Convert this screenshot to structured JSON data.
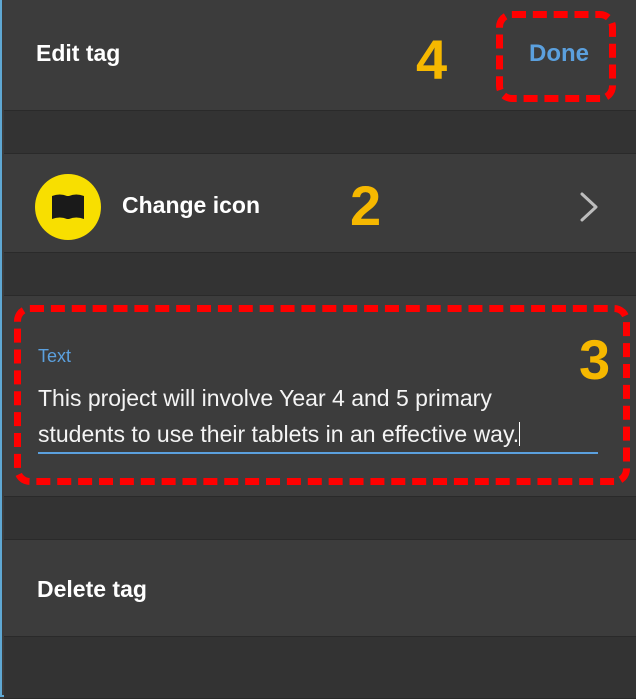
{
  "header": {
    "title": "Edit tag",
    "done_label": "Done"
  },
  "change_icon": {
    "label": "Change icon",
    "icon": "book-icon",
    "chevron": "chevron-right-icon",
    "icon_bg_color": "#f8df00"
  },
  "text_field": {
    "label": "Text",
    "lines": [
      "This project will involve Year 4 and 5 primary",
      "students to use their tablets in an effective way."
    ]
  },
  "delete": {
    "label": "Delete tag"
  },
  "annotations": {
    "step_done": "4",
    "step_change_icon": "2",
    "step_text": "3",
    "highlight_color": "#ff0000",
    "badge_color": "#f6b800"
  },
  "theme": {
    "accent": "#5ba0de",
    "background": "#3b3b3b"
  }
}
